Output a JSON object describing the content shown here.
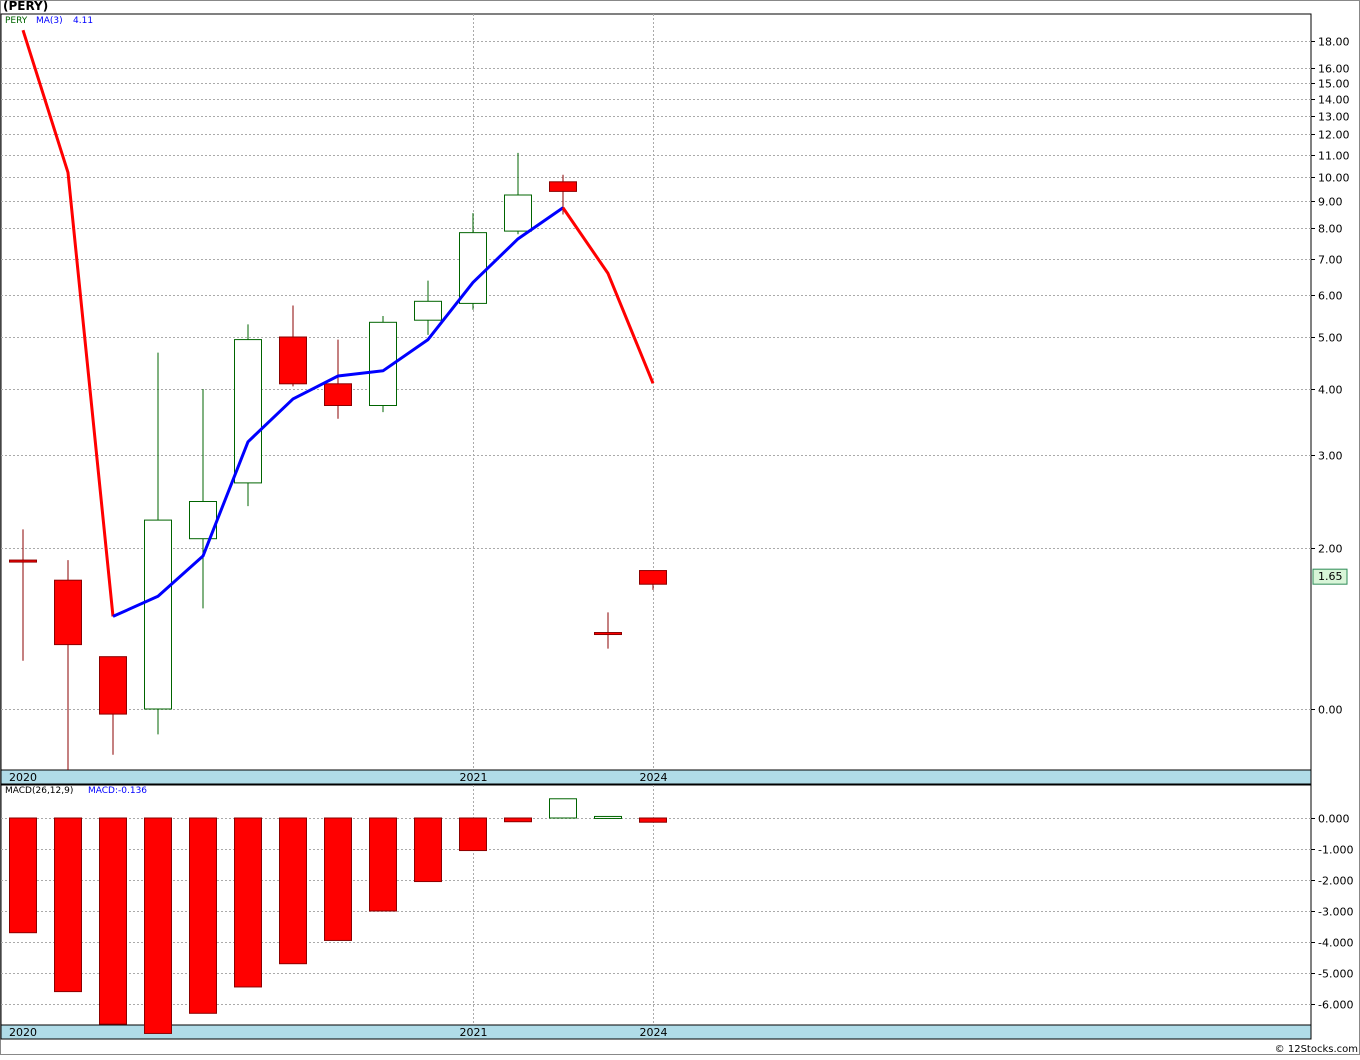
{
  "title": "(PERY)",
  "price_legend": {
    "symbol": "PERY",
    "ma_label": "MA(3)",
    "ma_value": "4.11"
  },
  "macd_legend": {
    "label": "MACD(26,12,9)",
    "value": "MACD:-0.136"
  },
  "last_price_tag": "1.65",
  "credit": "© 12Stocks.com",
  "colors": {
    "up": "#006400",
    "down": "#ff0000",
    "ma": "#0000ff",
    "axis_band": "#b0dce8",
    "last_tag_bg": "#d8f5d8",
    "grid": "#aaaaaa"
  },
  "chart_data": [
    {
      "type": "candlestick",
      "title": "(PERY)",
      "y_ticks": [
        "18.00",
        "16.00",
        "15.00",
        "14.00",
        "13.00",
        "12.00",
        "11.00",
        "10.00",
        "9.00",
        "8.00",
        "7.00",
        "6.00",
        "5.00",
        "4.00",
        "3.00",
        "2.00",
        "0.00"
      ],
      "x_tick_labels": [
        {
          "index": 0,
          "label": "2020"
        },
        {
          "index": 10,
          "label": "2021"
        },
        {
          "index": 14,
          "label": "2024"
        }
      ],
      "candles": [
        {
          "open": 1.85,
          "high": 2.2,
          "low": 0.6,
          "close": 1.85
        },
        {
          "open": 1.6,
          "high": 1.85,
          "low": -0.6,
          "close": 0.8
        },
        {
          "open": 0.65,
          "high": 0.65,
          "low": -0.45,
          "close": -0.05
        },
        {
          "open": 0.0,
          "high": 4.7,
          "low": -0.25,
          "close": 2.3
        },
        {
          "open": 2.1,
          "high": 4.0,
          "low": 1.25,
          "close": 2.5
        },
        {
          "open": 2.7,
          "high": 5.3,
          "low": 2.45,
          "close": 4.95
        },
        {
          "open": 5.0,
          "high": 5.75,
          "low": 4.05,
          "close": 4.1
        },
        {
          "open": 4.1,
          "high": 4.95,
          "low": 3.55,
          "close": 3.75
        },
        {
          "open": 3.75,
          "high": 5.5,
          "low": 3.65,
          "close": 5.35
        },
        {
          "open": 5.4,
          "high": 6.4,
          "low": 5.05,
          "close": 5.85
        },
        {
          "open": 5.8,
          "high": 8.55,
          "low": 5.65,
          "close": 7.85
        },
        {
          "open": 7.9,
          "high": 11.1,
          "low": 7.8,
          "close": 9.25
        },
        {
          "open": 9.8,
          "high": 10.1,
          "low": 8.5,
          "close": 9.4
        },
        {
          "open": 0.95,
          "high": 1.2,
          "low": 0.75,
          "close": 0.93
        },
        {
          "open": 1.72,
          "high": 1.72,
          "low": 1.48,
          "close": 1.55
        }
      ],
      "ma_blue": [
        {
          "index": 2,
          "value": 1.15
        },
        {
          "index": 3,
          "value": 1.4
        },
        {
          "index": 4,
          "value": 1.9
        },
        {
          "index": 5,
          "value": 3.2
        },
        {
          "index": 6,
          "value": 3.85
        },
        {
          "index": 7,
          "value": 4.25
        },
        {
          "index": 8,
          "value": 4.35
        },
        {
          "index": 9,
          "value": 4.95
        },
        {
          "index": 10,
          "value": 6.35
        },
        {
          "index": 11,
          "value": 7.65
        },
        {
          "index": 12,
          "value": 8.75
        }
      ],
      "ma_red": [
        {
          "index": 0,
          "value": 18.5
        },
        {
          "index": 1,
          "value": 10.2
        },
        {
          "index": 2,
          "value": 1.15
        }
      ],
      "ma_red_tail": [
        {
          "index": 12,
          "value": 8.75
        },
        {
          "index": 13,
          "value": 6.6
        },
        {
          "index": 14,
          "value": 4.11
        }
      ],
      "last_price": 1.65
    },
    {
      "type": "bar",
      "title": "MACD(26,12,9)",
      "y_ticks": [
        "0.000",
        "-1.000",
        "-2.000",
        "-3.000",
        "-4.000",
        "-5.000",
        "-6.000"
      ],
      "x_tick_labels": [
        {
          "index": 0,
          "label": "2020"
        },
        {
          "index": 10,
          "label": "2021"
        },
        {
          "index": 14,
          "label": "2024"
        }
      ],
      "values": [
        -3.7,
        -5.6,
        -6.65,
        -6.95,
        -6.3,
        -5.45,
        -4.7,
        -3.95,
        -3.0,
        -2.05,
        -1.05,
        -0.12,
        0.62,
        0.05,
        -0.136
      ]
    }
  ]
}
